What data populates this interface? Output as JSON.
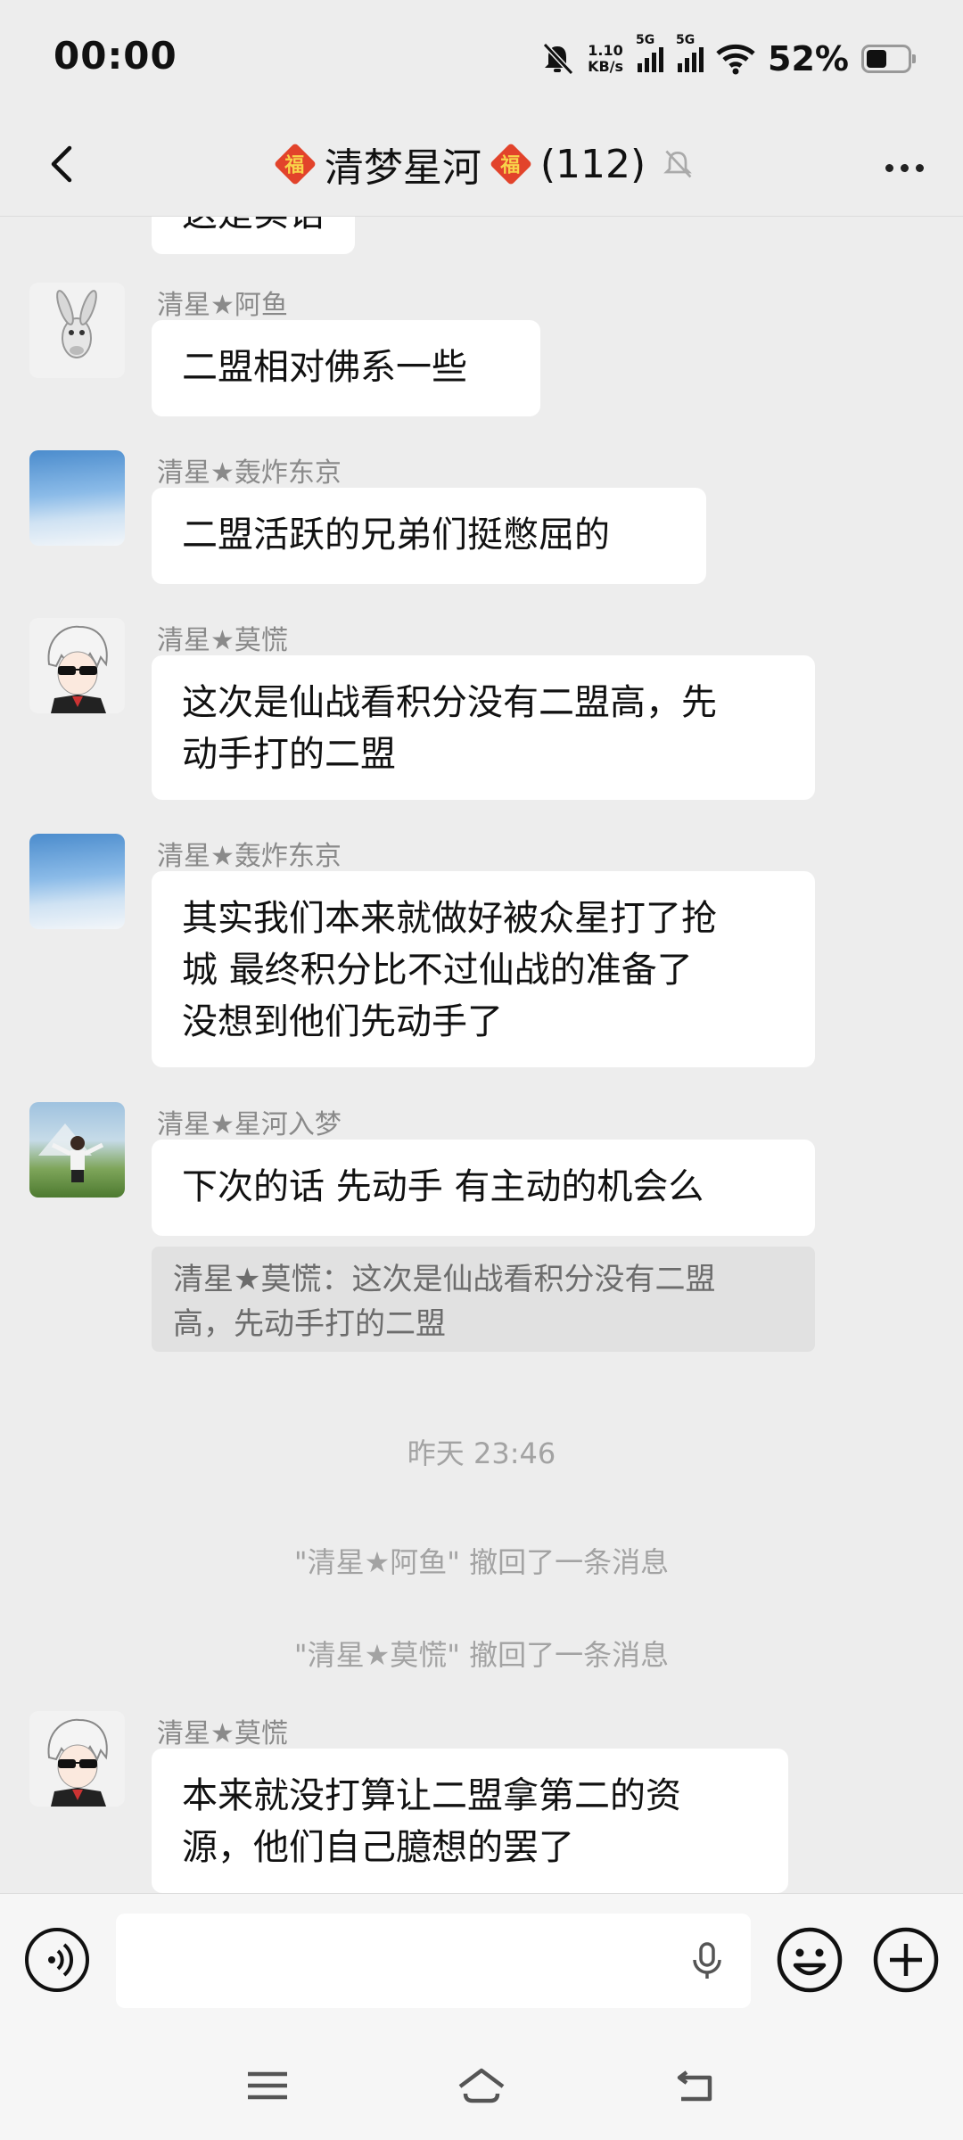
{
  "status_bar": {
    "time": "00:00",
    "net_speed_value": "1.10",
    "net_speed_unit": "KB/s",
    "sim1_label": "5G",
    "sim2_label": "5G",
    "battery_percent": "52%",
    "battery_level": 0.52
  },
  "header": {
    "title": "清梦星河",
    "member_count": "(112)"
  },
  "chat": {
    "partial_message": "这是实话",
    "messages": [
      {
        "sender": "清星★阿鱼",
        "lines": [
          "二盟相对佛系一些"
        ]
      },
      {
        "sender": "清星★轰炸东京",
        "lines": [
          "二盟活跃的兄弟们挺憋屈的"
        ]
      },
      {
        "sender": "清星★莫慌",
        "lines": [
          "这次是仙战看积分没有二盟高，先",
          "动手打的二盟"
        ]
      },
      {
        "sender": "清星★轰炸东京",
        "lines": [
          "其实我们本来就做好被众星打了抢",
          "城 最终积分比不过仙战的准备了",
          "没想到他们先动手了"
        ]
      },
      {
        "sender": "清星★星河入梦",
        "lines": [
          "下次的话 先动手 有主动的机会么"
        ],
        "quote_lines": [
          "清星★莫慌：这次是仙战看积分没有二盟",
          "高，先动手打的二盟"
        ]
      },
      {
        "sender": "清星★莫慌",
        "lines": [
          "本来就没打算让二盟拿第二的资",
          "源，他们自己臆想的罢了"
        ]
      }
    ],
    "timestamp": "昨天 23:46",
    "system_notices": [
      "\"清星★阿鱼\" 撤回了一条消息",
      "\"清星★莫慌\" 撤回了一条消息"
    ]
  },
  "input": {
    "value": "",
    "placeholder": ""
  },
  "colors": {
    "background": "#ededed",
    "bubble": "#ffffff",
    "quote": "#e1e1e1",
    "sender": "#8a8a8a",
    "system_text": "#a3a3a3"
  }
}
